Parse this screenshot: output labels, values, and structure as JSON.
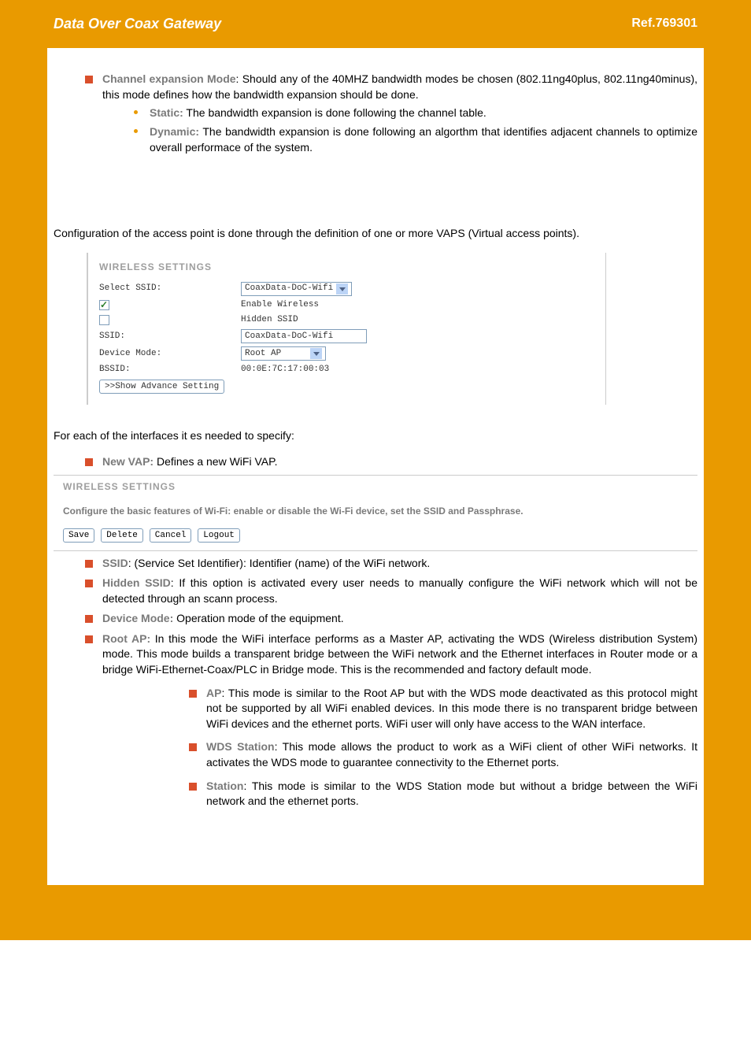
{
  "header": {
    "title": "Data Over Coax Gateway",
    "ref": "Ref.769301"
  },
  "section_channel": {
    "label": "Channel expansion Mode",
    "text1": ": Should  any of the 40MHZ bandwidth modes be chosen (802.11ng40plus, 802.11ng40minus), this mode defines how the bandwidth expansion should be done.",
    "static_label": "Static:",
    "static_text": " The bandwidth expansion is done following the channel table.",
    "dynamic_label": "Dynamic:",
    "dynamic_text": " The bandwidth  expansion is done following an algorthm that identifies adjacent channels to optimize overall performace of the system."
  },
  "para_vaps": "Configuration of the  access point is done through the definition of one or more VAPS (Virtual access points).",
  "wireless_panel1": {
    "title": "WIRELESS SETTINGS",
    "select_ssid_label": "Select SSID:",
    "select_ssid_value": "CoaxData-DoC-Wifi",
    "enable_wireless_label": "Enable Wireless",
    "hidden_ssid_label": "Hidden SSID",
    "ssid_label": "SSID:",
    "ssid_value": "CoaxData-DoC-Wifi",
    "device_mode_label": "Device Mode:",
    "device_mode_value": "Root AP",
    "bssid_label": "BSSID:",
    "bssid_value": "00:0E:7C:17:00:03",
    "show_advance_btn": ">>Show Advance Setting"
  },
  "para_interfaces": "For each of the interfaces it es needed to specify:",
  "new_vap": {
    "label": "New VAP:",
    "text": " Defines a new WiFi VAP."
  },
  "wireless_panel2": {
    "title": "WIRELESS SETTINGS",
    "desc": "Configure the basic features of Wi-Fi: enable or disable the Wi-Fi device, set the SSID and Passphrase.",
    "btn_save": "Save",
    "btn_delete": "Delete",
    "btn_cancel": "Cancel",
    "btn_logout": "Logout"
  },
  "defs": {
    "ssid_label": "SSID",
    "ssid_text": ": (Service Set Identifier): Identifier (name) of the WiFi network.",
    "hidden_label": "Hidden SSID",
    "hidden_text": ": If this option is activated every user needs to manually configure the WiFi network which will not be detected through an scann process.",
    "device_mode_label": "Device Mode:",
    "device_mode_text": " Operation mode of the equipment.",
    "root_ap_label": "Root AP:",
    "root_ap_text": " In this mode the WiFi interface performs as a Master AP, activating the WDS (Wireless distribution System) mode. This mode builds a transparent bridge between the WiFi network and the Ethernet interfaces in Router mode or a bridge WiFi-Ethernet-Coax/PLC in Bridge mode. This is the recommended and factory default mode.",
    "ap_label": "AP",
    "ap_text": ": This mode is similar to the Root AP but with the WDS mode deactivated as this protocol might not be supported by all WiFi enabled devices. In this mode there is no transparent bridge between WiFi devices and the ethernet ports. WiFi user will only have access to the WAN interface.",
    "wds_label": "WDS Station",
    "wds_text": ": This mode allows the product to work as a WiFi client of other WiFi networks. It activates the WDS mode to guarantee connectivity to the Ethernet ports.",
    "station_label": "Station",
    "station_text": ": This mode is similar to the WDS Station mode but without a bridge between the WiFi network and the ethernet ports."
  }
}
